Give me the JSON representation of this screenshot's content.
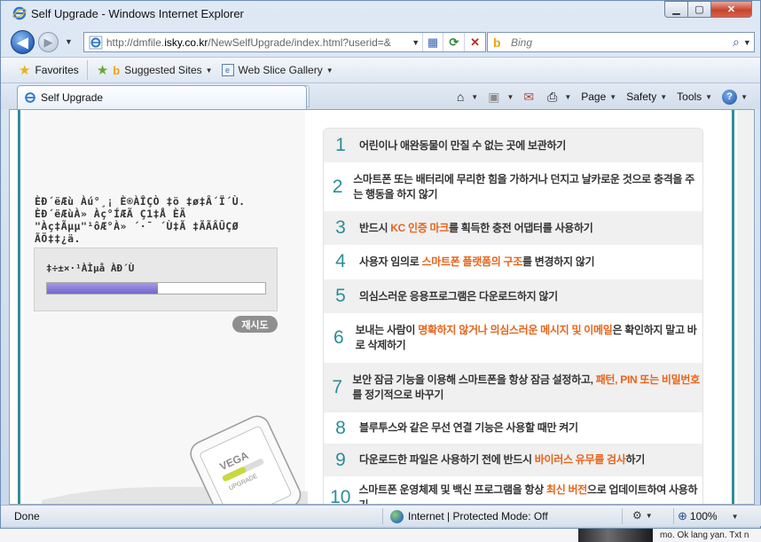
{
  "window": {
    "title": "Self Upgrade - Windows Internet Explorer"
  },
  "nav": {
    "address_url_prefix": "http://dmfile.",
    "address_url_domain": "isky.co.kr",
    "address_url_suffix": "/NewSelfUpgrade/index.html?userid=&",
    "search_placeholder": "Bing"
  },
  "favorites_bar": {
    "favorites_label": "Favorites",
    "items": [
      {
        "label": "Suggested Sites",
        "icon": "bing-icon"
      },
      {
        "label": "Web Slice Gallery",
        "icon": "web-slice-icon"
      }
    ]
  },
  "tabs": [
    {
      "label": "Self Upgrade",
      "active": true
    }
  ],
  "command_bar": {
    "page_label": "Page",
    "safety_label": "Safety",
    "tools_label": "Tools"
  },
  "left_panel": {
    "garbled_message_lines": [
      "ÈÐ´ëÆù Àú°¸¡ È®ÀÎÇÒ ‡ö ‡ø‡Â´Ï´Ù.",
      "ÈÐ´ëÆùÀ» Àç°ÍÆÃ Ç1‡Å ÈÄ",
      "\"Àç‡Ãµµ\"¹ôÆ°À» ´·¯ ´Ù‡Ã ‡ÃÃÂÛÇØ",
      "ÃÖ‡‡¿ä."
    ],
    "progress_label": "‡÷±×·¹ÀÌµå ÀÐ´Ù",
    "progress_fraction": 0.51,
    "retry_button": "재시도",
    "illustration_brand": "VEGA",
    "illustration_sub": "UPGRADE"
  },
  "safety_tips": [
    {
      "num": "1",
      "parts": [
        {
          "t": "어린이나 애완동물이 만질 수 없는 곳",
          "hl": false
        },
        {
          "t": "에 보관하기",
          "hl": false
        }
      ]
    },
    {
      "num": "2",
      "parts": [
        {
          "t": "스마트폰 또는 배터리에 무리한 힘을 가하거나 던지고 날카로운 것으로 충격을 주는 행동을 하지 않기",
          "hl": false
        }
      ]
    },
    {
      "num": "3",
      "parts": [
        {
          "t": "반드시 ",
          "hl": false
        },
        {
          "t": "KC 인증 마크",
          "hl": true
        },
        {
          "t": "를 획득한 충전 어댑터를 사용하기",
          "hl": false
        }
      ]
    },
    {
      "num": "4",
      "parts": [
        {
          "t": "사용자 임의로 ",
          "hl": false
        },
        {
          "t": "스마트폰 플랫폼의 구조",
          "hl": true
        },
        {
          "t": "를 변경하지 않기",
          "hl": false
        }
      ]
    },
    {
      "num": "5",
      "parts": [
        {
          "t": "의심스러운 응용프로그램은 다운로드하지 않기",
          "hl": false
        }
      ]
    },
    {
      "num": "6",
      "parts": [
        {
          "t": "보내는 사람이 ",
          "hl": false
        },
        {
          "t": "명확하지 않거나 의심스러운 메시지 및 이메일",
          "hl": true
        },
        {
          "t": "은 확인하지 말고 바로 삭제하기",
          "hl": false
        }
      ]
    },
    {
      "num": "7",
      "parts": [
        {
          "t": "보안 잠금 기능을 이용해 스마트폰을 항상 잠금 설정하고, ",
          "hl": false
        },
        {
          "t": "패턴, PIN 또는 비밀번호",
          "hl": true
        },
        {
          "t": "를 정기적으로 바꾸기",
          "hl": false
        }
      ]
    },
    {
      "num": "8",
      "parts": [
        {
          "t": "블루투스와 같은 무선 연결 기능은 사용할 때만 켜기",
          "hl": false
        }
      ]
    },
    {
      "num": "9",
      "parts": [
        {
          "t": "다운로드한 파일은 사용하기 전에 반드시 ",
          "hl": false
        },
        {
          "t": "바이러스 유무를 검사",
          "hl": true
        },
        {
          "t": "하기",
          "hl": false
        }
      ]
    },
    {
      "num": "10",
      "parts": [
        {
          "t": "스마트폰 운영체제 및 백신 프로그램을 항상 ",
          "hl": false
        },
        {
          "t": "최신 버전",
          "hl": true
        },
        {
          "t": "으로 업데이트하여 사용하기",
          "hl": false
        }
      ]
    }
  ],
  "status_bar": {
    "status_text": "Done",
    "zone_text": "Internet | Protected Mode: Off",
    "zoom": "100%"
  },
  "taskbar_strip": {
    "text": "mo. Ok lang yan. Txt n"
  },
  "colors": {
    "teal_accent": "#2f8e99",
    "highlight_orange": "#e8641a",
    "progress_purple": "#7465cf"
  }
}
